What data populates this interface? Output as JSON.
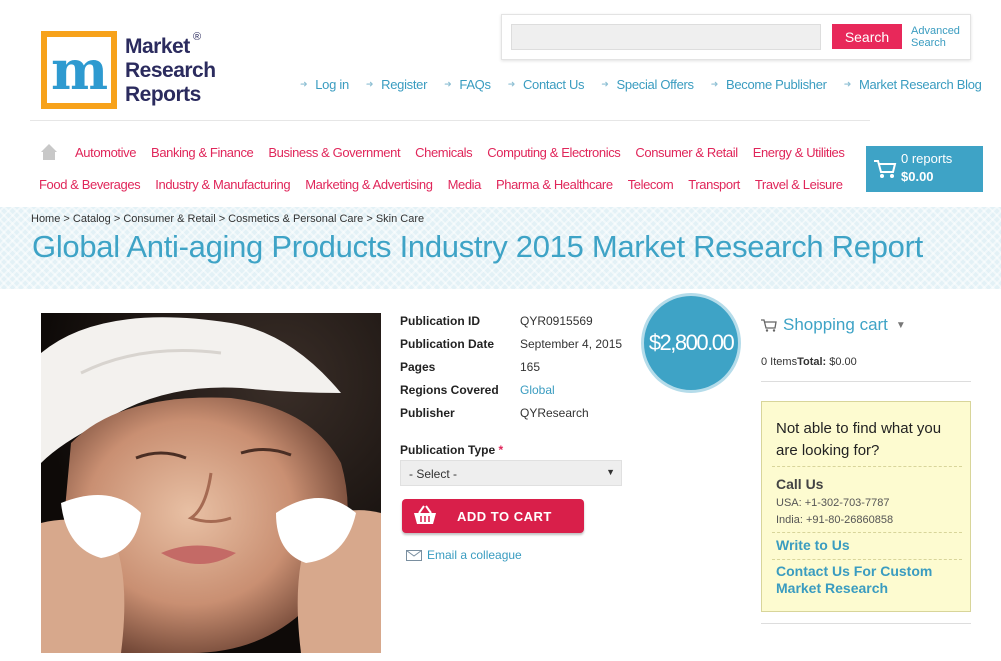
{
  "logo": {
    "line1": "Market",
    "line2": "Research",
    "line3": "Reports",
    "registered": "®"
  },
  "search": {
    "value": "",
    "placeholder": "",
    "button_label": "Search",
    "advanced_line1": "Advanced",
    "advanced_line2": "Search"
  },
  "top_links": [
    "Log in",
    "Register",
    "FAQs",
    "Contact Us",
    "Special Offers",
    "Become Publisher",
    "Market Research Blog"
  ],
  "nav": {
    "row1": [
      "Automotive",
      "Banking & Finance",
      "Business & Government",
      "Chemicals",
      "Computing & Electronics",
      "Consumer & Retail",
      "Energy & Utilities"
    ],
    "row2": [
      "Food & Beverages",
      "Industry & Manufacturing",
      "Marketing & Advertising",
      "Media",
      "Pharma & Healthcare",
      "Telecom",
      "Transport",
      "Travel & Leisure"
    ]
  },
  "cart_button": {
    "reports": "0 reports",
    "total": "$0.00"
  },
  "breadcrumb": "Home > Catalog > Consumer & Retail > Cosmetics & Personal Care > Skin Care",
  "title": "Global Anti-aging Products Industry 2015 Market Research Report",
  "details": {
    "pub_id_label": "Publication ID",
    "pub_id": "QYR0915569",
    "pub_date_label": "Publication Date",
    "pub_date": "September 4, 2015",
    "pages_label": "Pages",
    "pages": "165",
    "regions_label": "Regions Covered",
    "regions": "Global",
    "publisher_label": "Publisher",
    "publisher": "QYResearch"
  },
  "price": "$2,800.00",
  "publication_type": {
    "label": "Publication Type",
    "required_mark": "*",
    "selected": "- Select -"
  },
  "add_to_cart": "ADD TO CART",
  "email_colleague": "Email a colleague",
  "sidebar": {
    "cart_title": "Shopping cart",
    "items": "0 Items",
    "total_label": "Total:",
    "total_value": "$0.00",
    "help_title": "Not able to find what you are looking for?",
    "call_us": "Call Us",
    "phone_usa": "USA: +1-302-703-7787",
    "phone_india": "India: +91-80-26860858",
    "write_to_us": "Write to Us",
    "custom_research": "Contact Us For Custom Market Research"
  },
  "colors": {
    "accent_blue": "#3ea3c6",
    "accent_pink": "#e0265a",
    "logo_orange": "#f7a21a"
  }
}
